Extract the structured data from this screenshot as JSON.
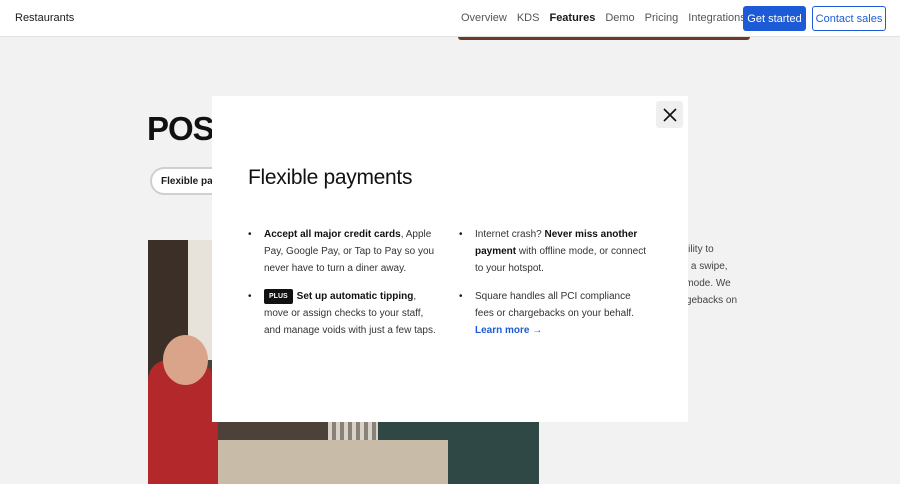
{
  "nav": {
    "brand": "Restaurants",
    "links": [
      {
        "label": "Overview",
        "active": false
      },
      {
        "label": "KDS",
        "active": false
      },
      {
        "label": "Features",
        "active": true
      },
      {
        "label": "Demo",
        "active": false
      },
      {
        "label": "Pricing",
        "active": false
      },
      {
        "label": "Integrations",
        "active": false
      }
    ],
    "get_started": "Get started",
    "contact_sales": "Contact sales"
  },
  "background": {
    "section_title": "POS s",
    "pill_label": "Flexible pay",
    "text_lines": [
      "ability to",
      "gh a swipe,",
      "e mode. We",
      "argebacks on"
    ]
  },
  "modal": {
    "title": "Flexible payments",
    "close_icon": "close-icon",
    "left": {
      "item1": {
        "bold": "Accept all major credit cards",
        "rest": ", Apple Pay, Google Pay, or Tap to Pay so you never have to turn a diner away."
      },
      "item2": {
        "badge": "PLUS",
        "bold": "Set up automatic tipping",
        "rest": ", move or assign checks to your staff, and manage voids with just a few taps."
      }
    },
    "right": {
      "item1": {
        "pre": "Internet crash? ",
        "bold": "Never miss another payment",
        "rest": " with offline mode, or connect to your hotspot."
      },
      "item2": {
        "pre": "Square handles all PCI compliance fees or chargebacks on your behalf. ",
        "link": "Learn more →"
      }
    }
  },
  "colors": {
    "accent": "#1d5bd6",
    "badge": "#111111",
    "page_bg": "#f2f2f2"
  }
}
